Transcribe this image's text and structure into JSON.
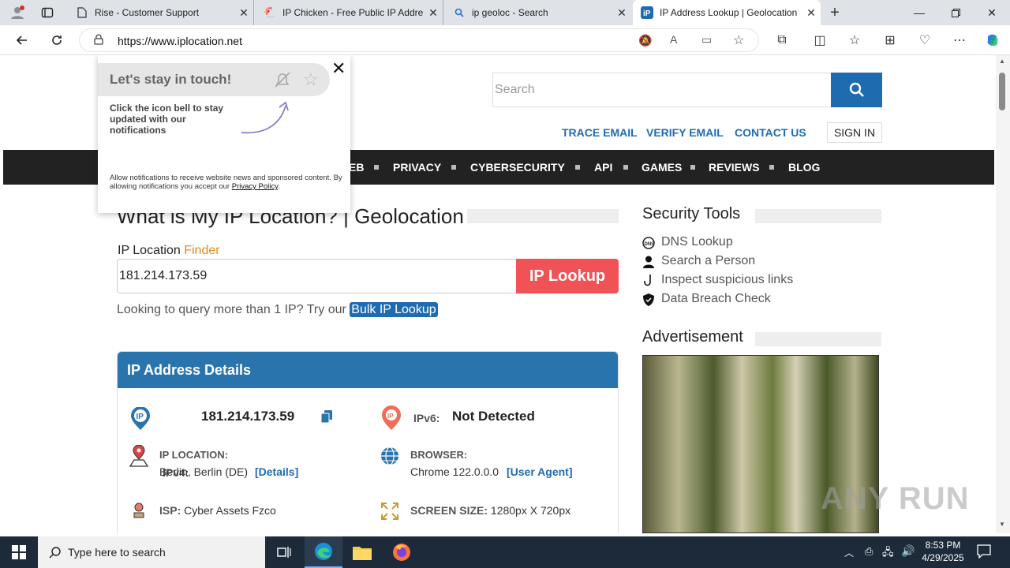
{
  "browser": {
    "tabs": [
      {
        "title": "Rise - Customer Support",
        "icon": "page-icon"
      },
      {
        "title": "IP Chicken - Free Public IP Addre",
        "icon": "chicken-icon"
      },
      {
        "title": "ip geoloc - Search",
        "icon": "search-icon"
      },
      {
        "title": "IP Address Lookup | Geolocation",
        "icon": "iplocation-icon",
        "active": true
      }
    ],
    "new_tab": "+",
    "url": "https://www.iplocation.net"
  },
  "site": {
    "search_placeholder": "Search",
    "top_links": [
      "TRACE EMAIL",
      "VERIFY EMAIL",
      "CONTACT US"
    ],
    "sign_in": "SIGN IN",
    "nav": [
      "EB",
      "PRIVACY",
      "CYBERSECURITY",
      "API",
      "GAMES",
      "REVIEWS",
      "BLOG"
    ]
  },
  "main": {
    "heading": "What is My IP Location? | Geolocation",
    "finder_label": "IP Location",
    "finder_accent": "Finder",
    "ip_input_value": "181.214.173.59",
    "lookup_button": "IP Lookup",
    "bulk_text": "Looking to query more than 1 IP? Try our",
    "bulk_link": "Bulk IP Lookup",
    "details_title": "IP Address Details",
    "ipv4_label": "IPv4:",
    "ipv4_value": "181.214.173.59",
    "ipv6_label": "IPv6:",
    "ipv6_value": "Not Detected",
    "location_label": "IP LOCATION:",
    "location_value": "Berlin, Berlin (DE)",
    "details_link": "[Details]",
    "browser_label": "BROWSER:",
    "browser_value": "Chrome 122.0.0.0",
    "user_agent_link": "[User Agent]",
    "isp_label": "ISP:",
    "isp_value": "Cyber Assets Fzco",
    "screen_label": "SCREEN SIZE:",
    "screen_value": "1280px X 720px"
  },
  "sidebar": {
    "security_title": "Security Tools",
    "tools": [
      "DNS Lookup",
      "Search a Person",
      "Inspect suspicious links",
      "Data Breach Check"
    ],
    "ad_title": "Advertisement"
  },
  "popup": {
    "title": "Let's stay in touch!",
    "description": "Click the icon bell to stay updated with our notifications",
    "legal": "Allow notifications to receive website news and sponsored content. By allowing notifications you accept our",
    "legal_link": "Privacy Policy",
    "close": "✕"
  },
  "watermark": "ANY RUN",
  "taskbar": {
    "search_placeholder": "Type here to search",
    "time": "8:53 PM",
    "date": "4/29/2025"
  },
  "colors": {
    "brand_blue": "#1f6bb0",
    "lookup_red": "#f05256",
    "finder_orange": "#e8891e",
    "nav_dark": "#222222"
  }
}
